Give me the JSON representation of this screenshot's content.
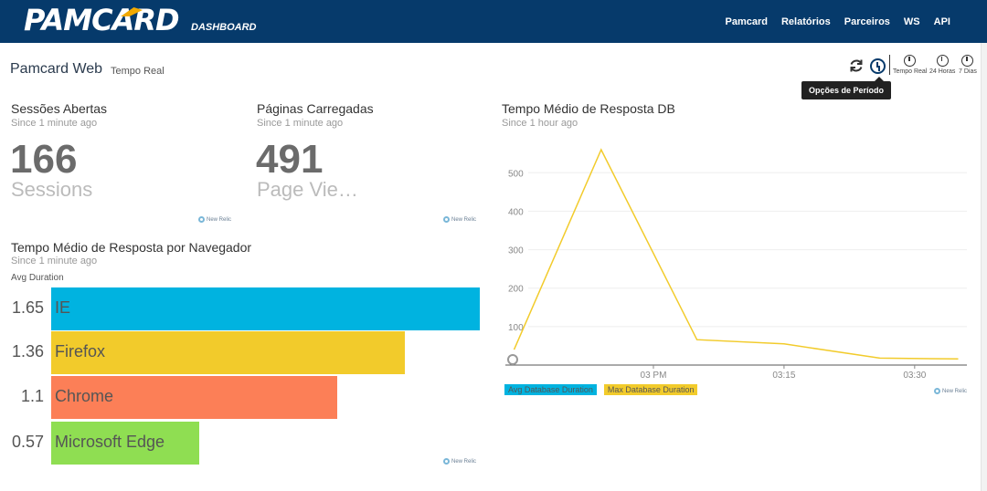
{
  "nav": {
    "logo": "PAMCARD",
    "logo_sub": "DASHBOARD",
    "items": [
      "Pamcard",
      "Relatórios",
      "Parceiros",
      "WS",
      "API"
    ]
  },
  "header": {
    "title": "Pamcard Web",
    "subtitle": "Tempo Real",
    "tooltip": "Opções de Período",
    "periods": [
      "Tempo Real",
      "24 Horas",
      "7 Dias"
    ]
  },
  "widgets": {
    "sessions": {
      "title": "Sessões Abertas",
      "since": "Since 1 minute ago",
      "value": "166",
      "unit": "Sessions",
      "brand": "New Relic"
    },
    "pages": {
      "title": "Páginas Carregadas",
      "since": "Since 1 minute ago",
      "value": "491",
      "unit": "Page Vie…",
      "brand": "New Relic"
    },
    "browser": {
      "title": "Tempo Médio de Resposta por Navegador",
      "since": "Since 1 minute ago",
      "column_label": "Avg Duration",
      "brand": "New Relic",
      "rows": [
        {
          "name": "IE",
          "value": "1.65",
          "num": 1.65,
          "color": "#00b3e0"
        },
        {
          "name": "Firefox",
          "value": "1.36",
          "num": 1.36,
          "color": "#f2cb2b"
        },
        {
          "name": "Chrome",
          "value": "1.1",
          "num": 1.1,
          "color": "#fc7f57"
        },
        {
          "name": "Microsoft Edge",
          "value": "0.57",
          "num": 0.57,
          "color": "#8fde52"
        }
      ]
    },
    "db": {
      "title": "Tempo Médio de Resposta DB",
      "since": "Since 1 hour ago",
      "brand": "New Relic"
    }
  },
  "chart_data": {
    "type": "line",
    "title": "Tempo Médio de Resposta DB",
    "x_tick_labels": [
      "03 PM",
      "03:15",
      "03:30"
    ],
    "y_ticks": [
      100,
      200,
      300,
      400,
      500
    ],
    "ylim": [
      0,
      560
    ],
    "grid": true,
    "legend_position": "bottom-left",
    "series": [
      {
        "name": "Avg Database Duration",
        "color": "#00b3e0",
        "points": []
      },
      {
        "name": "Max Database Duration",
        "color": "#f2cb2b",
        "points": [
          {
            "x_minutes": -16,
            "y": 40
          },
          {
            "x_minutes": -6,
            "y": 560
          },
          {
            "x_minutes": 5,
            "y": 66
          },
          {
            "x_minutes": 15,
            "y": 55
          },
          {
            "x_minutes": 26,
            "y": 18
          },
          {
            "x_minutes": 35,
            "y": 16
          }
        ]
      }
    ]
  }
}
